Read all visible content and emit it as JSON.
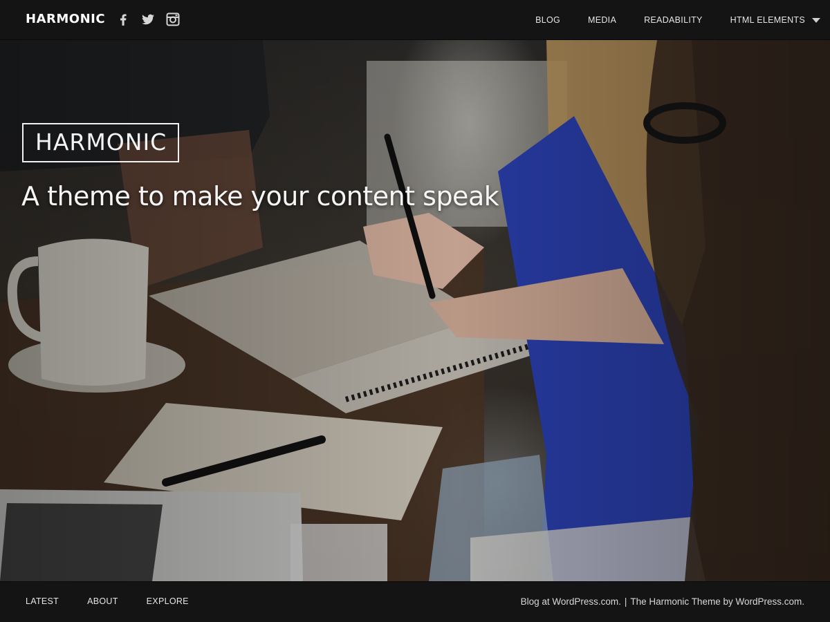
{
  "header": {
    "site_title": "HARMONIC",
    "social": [
      {
        "icon": "facebook-icon"
      },
      {
        "icon": "twitter-icon"
      },
      {
        "icon": "instagram-icon"
      }
    ],
    "nav": [
      {
        "label": "BLOG"
      },
      {
        "label": "MEDIA"
      },
      {
        "label": "READABILITY"
      },
      {
        "label": "HTML ELEMENTS",
        "icon": "chevron-down-icon"
      }
    ]
  },
  "hero": {
    "brand": "HARMONIC",
    "tagline": "A theme to make your content speak"
  },
  "footer": {
    "nav": [
      {
        "label": "LATEST"
      },
      {
        "label": "ABOUT"
      },
      {
        "label": "EXPLORE"
      }
    ],
    "credit_left": "Blog at WordPress.com.",
    "separator": "|",
    "credit_right": "The Harmonic Theme by WordPress.com."
  },
  "colors": {
    "bar_background": "#141414",
    "text": "#e6e6e6",
    "accent_blue": "#2a3fae"
  }
}
